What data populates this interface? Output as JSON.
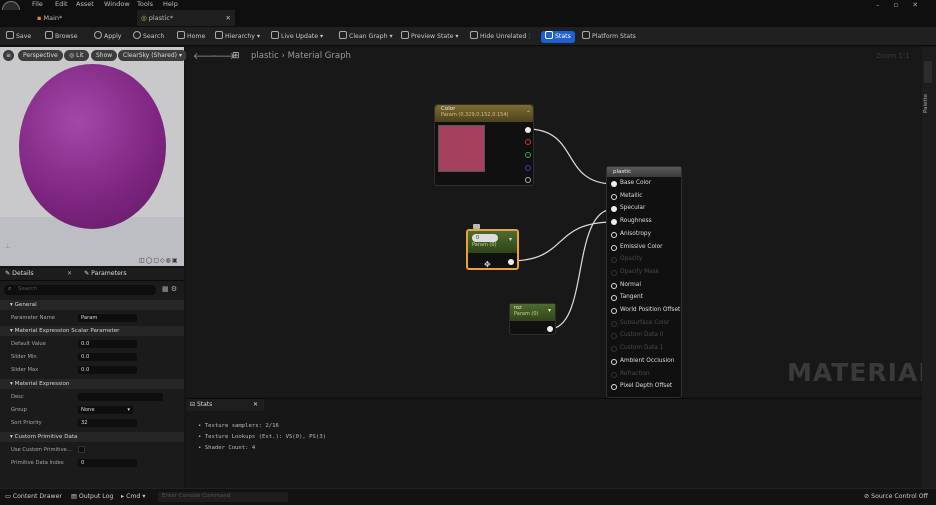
{
  "menu": [
    "File",
    "Edit",
    "Asset",
    "Window",
    "Tools",
    "Help"
  ],
  "tabs": [
    {
      "label": "Main*"
    },
    {
      "label": "plastic*"
    }
  ],
  "toolbar": {
    "save": "Save",
    "browse": "Browse",
    "apply": "Apply",
    "search": "Search",
    "home": "Home",
    "hierarchy": "Hierarchy",
    "live_update": "Live Update",
    "clean_graph": "Clean Graph",
    "preview_state": "Preview State",
    "hide_unrelated": "Hide Unrelated",
    "stats": "Stats",
    "platform_stats": "Platform Stats"
  },
  "viewport": {
    "perspective": "Perspective",
    "lit": "Lit",
    "show": "Show",
    "sky": "ClearSky (Shared)"
  },
  "graph": {
    "breadcrumb_root": "plastic",
    "breadcrumb_child": "Material Graph",
    "zoom": "Zoom 1:1",
    "watermark": "MATERIAL"
  },
  "details": {
    "tab_details": "Details",
    "tab_parameters": "Parameters",
    "search_placeholder": "Search",
    "general": "General",
    "param_name_label": "Parameter Name",
    "param_name_value": "Param",
    "scalar_section": "Material Expression Scalar Parameter",
    "default_value_label": "Default Value",
    "default_value": "0.0",
    "slider_min_label": "Slider Min",
    "slider_min": "0.0",
    "slider_max_label": "Slider Max",
    "slider_max": "0.0",
    "expression_section": "Material Expression",
    "desc_label": "Desc",
    "desc_value": "",
    "group_label": "Group",
    "group_value": "None",
    "sort_label": "Sort Priority",
    "sort_value": "32",
    "custom_section": "Custom Primitive Data",
    "use_custom_label": "Use Custom Primitive...",
    "primitive_index_label": "Primitive Data Index",
    "primitive_index": "0"
  },
  "nodes": {
    "color": {
      "title": "Color",
      "subtitle": "Param (0.329,0.152,0.154)",
      "swatch": "#a5415f"
    },
    "scalar": {
      "value": "0",
      "subtitle": "Param (0)"
    },
    "roughness": {
      "title": "roz",
      "subtitle": "Param (0)"
    },
    "output": {
      "title": "plastic",
      "inputs": [
        {
          "label": "Base Color",
          "active": true
        },
        {
          "label": "Metallic",
          "active": true
        },
        {
          "label": "Specular",
          "active": true
        },
        {
          "label": "Roughness",
          "active": true
        },
        {
          "label": "Anisotropy",
          "active": true
        },
        {
          "label": "Emissive Color",
          "active": true
        },
        {
          "label": "Opacity",
          "active": false
        },
        {
          "label": "Opacity Mask",
          "active": false
        },
        {
          "label": "Normal",
          "active": true
        },
        {
          "label": "Tangent",
          "active": true
        },
        {
          "label": "World Position Offset",
          "active": true
        },
        {
          "label": "Subsurface Color",
          "active": false
        },
        {
          "label": "Custom Data 0",
          "active": false
        },
        {
          "label": "Custom Data 1",
          "active": false
        },
        {
          "label": "Ambient Occlusion",
          "active": true
        },
        {
          "label": "Refraction",
          "active": false
        },
        {
          "label": "Pixel Depth Offset",
          "active": true
        }
      ]
    }
  },
  "stats": {
    "tab": "Stats",
    "lines": [
      "Texture samplers: 2/16",
      "Texture Lookups (Est.): VS(0), PS(3)",
      "Shader Count: 4"
    ]
  },
  "right_strip": "Palette",
  "status": {
    "content_drawer": "Content Drawer",
    "output_log": "Output Log",
    "cmd": "Cmd",
    "console_placeholder": "Enter Console Command",
    "source_control": "Source Control Off"
  }
}
